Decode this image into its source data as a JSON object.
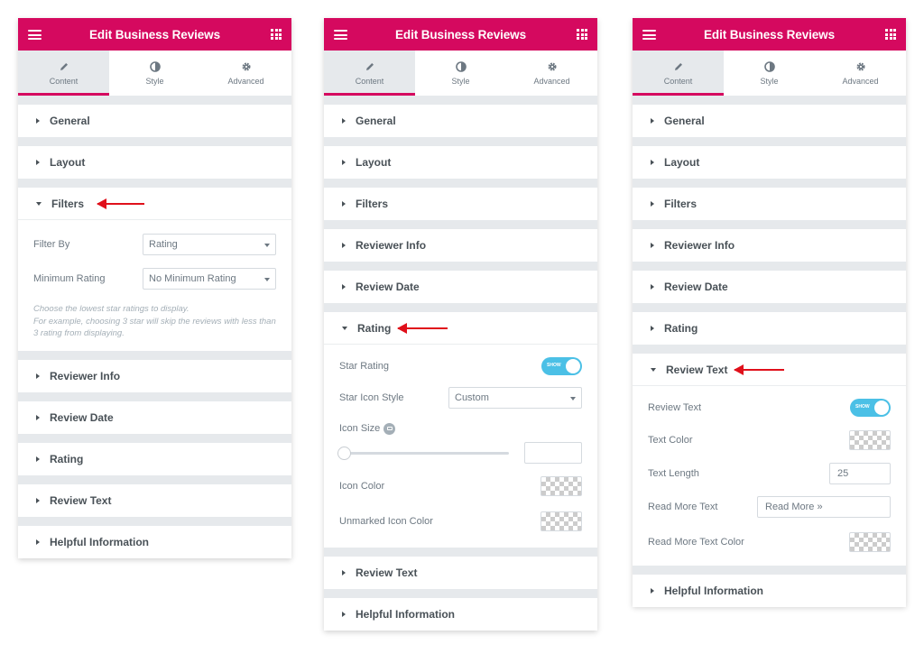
{
  "panels": [
    {
      "title": "Edit Business Reviews",
      "tabs": [
        "Content",
        "Style",
        "Advanced"
      ],
      "sections": {
        "general": "General",
        "layout": "Layout",
        "filters": "Filters",
        "reviewer_info": "Reviewer Info",
        "review_date": "Review Date",
        "rating": "Rating",
        "review_text": "Review Text",
        "helpful_information": "Helpful Information"
      },
      "filters": {
        "filter_by_label": "Filter By",
        "filter_by_value": "Rating",
        "min_rating_label": "Minimum Rating",
        "min_rating_value": "No Minimum Rating",
        "note_line1": "Choose the lowest star ratings to display.",
        "note_line2": "For example, choosing 3 star will skip the reviews with less than 3 rating from displaying."
      }
    },
    {
      "title": "Edit Business Reviews",
      "tabs": [
        "Content",
        "Style",
        "Advanced"
      ],
      "sections": {
        "general": "General",
        "layout": "Layout",
        "filters": "Filters",
        "reviewer_info": "Reviewer Info",
        "review_date": "Review Date",
        "rating": "Rating",
        "review_text": "Review Text",
        "helpful_information": "Helpful Information"
      },
      "rating": {
        "star_rating_label": "Star Rating",
        "star_rating_toggle": "SHOW",
        "star_icon_style_label": "Star Icon Style",
        "star_icon_style_value": "Custom",
        "icon_size_label": "Icon Size",
        "icon_size_value": "",
        "icon_color_label": "Icon Color",
        "unmarked_icon_color_label": "Unmarked Icon Color"
      }
    },
    {
      "title": "Edit Business Reviews",
      "tabs": [
        "Content",
        "Style",
        "Advanced"
      ],
      "sections": {
        "general": "General",
        "layout": "Layout",
        "filters": "Filters",
        "reviewer_info": "Reviewer Info",
        "review_date": "Review Date",
        "rating": "Rating",
        "review_text": "Review Text",
        "helpful_information": "Helpful Information"
      },
      "review_text": {
        "review_text_label": "Review Text",
        "review_text_toggle": "SHOW",
        "text_color_label": "Text Color",
        "text_length_label": "Text Length",
        "text_length_value": "25",
        "read_more_text_label": "Read More Text",
        "read_more_text_value": "Read More »",
        "read_more_text_color_label": "Read More Text Color"
      }
    }
  ],
  "colors": {
    "brand": "#d5095f",
    "toggle": "#4bc0e6",
    "arrow": "#e0101b"
  },
  "icons": [
    "hamburger-icon",
    "apps-grid-icon",
    "pencil-icon",
    "contrast-icon",
    "gear-icon",
    "info-icon",
    "red-arrow-annotation"
  ]
}
